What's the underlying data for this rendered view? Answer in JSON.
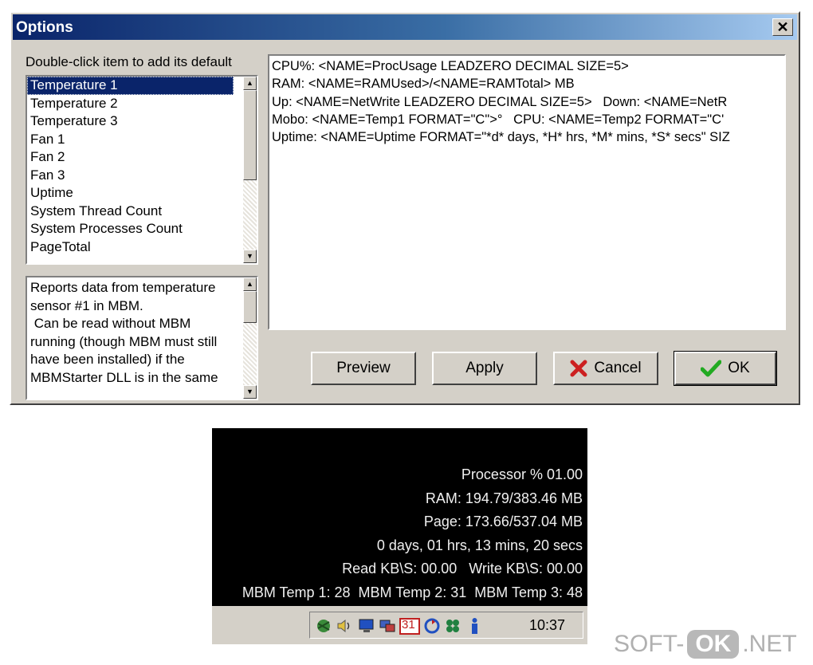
{
  "dialog": {
    "title": "Options",
    "close_label": "✕",
    "hint": "Double-click item to add its default",
    "list_items": [
      "Temperature 1",
      "Temperature 2",
      "Temperature 3",
      "Fan 1",
      "Fan 2",
      "Fan 3",
      "Uptime",
      "System Thread Count",
      "System Processes Count",
      "PageTotal"
    ],
    "selected_index": 0,
    "description": "Reports data from temperature\nsensor #1 in MBM.\n Can be read without MBM\nrunning (though MBM must still\nhave been installed) if the\nMBMStarter DLL is in the same",
    "editor_lines": [
      "CPU%: <NAME=ProcUsage LEADZERO DECIMAL SIZE=5>",
      "RAM: <NAME=RAMUsed>/<NAME=RAMTotal> MB",
      "Up: <NAME=NetWrite LEADZERO DECIMAL SIZE=5>   Down: <NAME=NetR",
      "Mobo: <NAME=Temp1 FORMAT=\"C\">°   CPU: <NAME=Temp2 FORMAT=\"C'",
      "Uptime: <NAME=Uptime FORMAT=\"*d* days, *H* hrs, *M* mins, *S* secs\" SIZ"
    ],
    "buttons": {
      "preview": "Preview",
      "apply": "Apply",
      "cancel": "Cancel",
      "ok": "OK"
    }
  },
  "stats": {
    "lines": [
      "Processor % 01.00",
      "RAM: 194.79/383.46 MB",
      "Page: 173.66/537.04 MB",
      "0 days, 01 hrs, 13 mins, 20 secs",
      "Read KB\\S: 00.00   Write KB\\S: 00.00",
      "MBM Temp 1: 28  MBM Temp 2: 31  MBM Temp 3: 48"
    ]
  },
  "taskbar": {
    "clock": "10:37",
    "calendar_day": "31",
    "tray_icons": [
      "network-icon",
      "volume-icon",
      "display-icon",
      "monitor-icon",
      "calendar-icon",
      "sync-icon",
      "clover-icon",
      "info-icon"
    ]
  },
  "watermark": {
    "prefix": "SOFT-",
    "badge": "OK",
    "suffix": ".NET"
  },
  "colors": {
    "title_start": "#0a246a",
    "title_end": "#a6caf0",
    "face": "#d4d0c8",
    "selection": "#0a246a",
    "cancel_icon": "#cc2020",
    "ok_icon": "#22aa22"
  }
}
